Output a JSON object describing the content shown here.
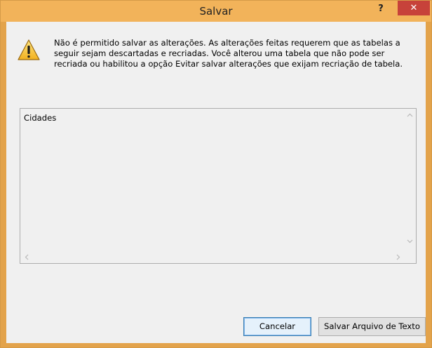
{
  "window": {
    "title": "Salvar",
    "help_label": "?",
    "close_label": "✕"
  },
  "message": {
    "text": "Não é permitido salvar as alterações. As alterações feitas requerem que as tabelas a seguir sejam descartadas e recriadas. Você alterou uma tabela que não pode ser recriada ou habilitou a opção Evitar salvar alterações que exijam recriação de tabela."
  },
  "list": {
    "items": [
      "Cidades"
    ]
  },
  "buttons": {
    "cancel_label": "Cancelar",
    "save_text_label": "Salvar Arquivo de Texto"
  },
  "icons": {
    "warning": "warning-icon",
    "scroll_up": "chevron-up-icon",
    "scroll_down": "chevron-down-icon",
    "scroll_left": "chevron-left-icon",
    "scroll_right": "chevron-right-icon"
  },
  "colors": {
    "titlebar": "#f2b35a",
    "close_button": "#c7423a",
    "focused_button_border": "#3c7fb1"
  }
}
